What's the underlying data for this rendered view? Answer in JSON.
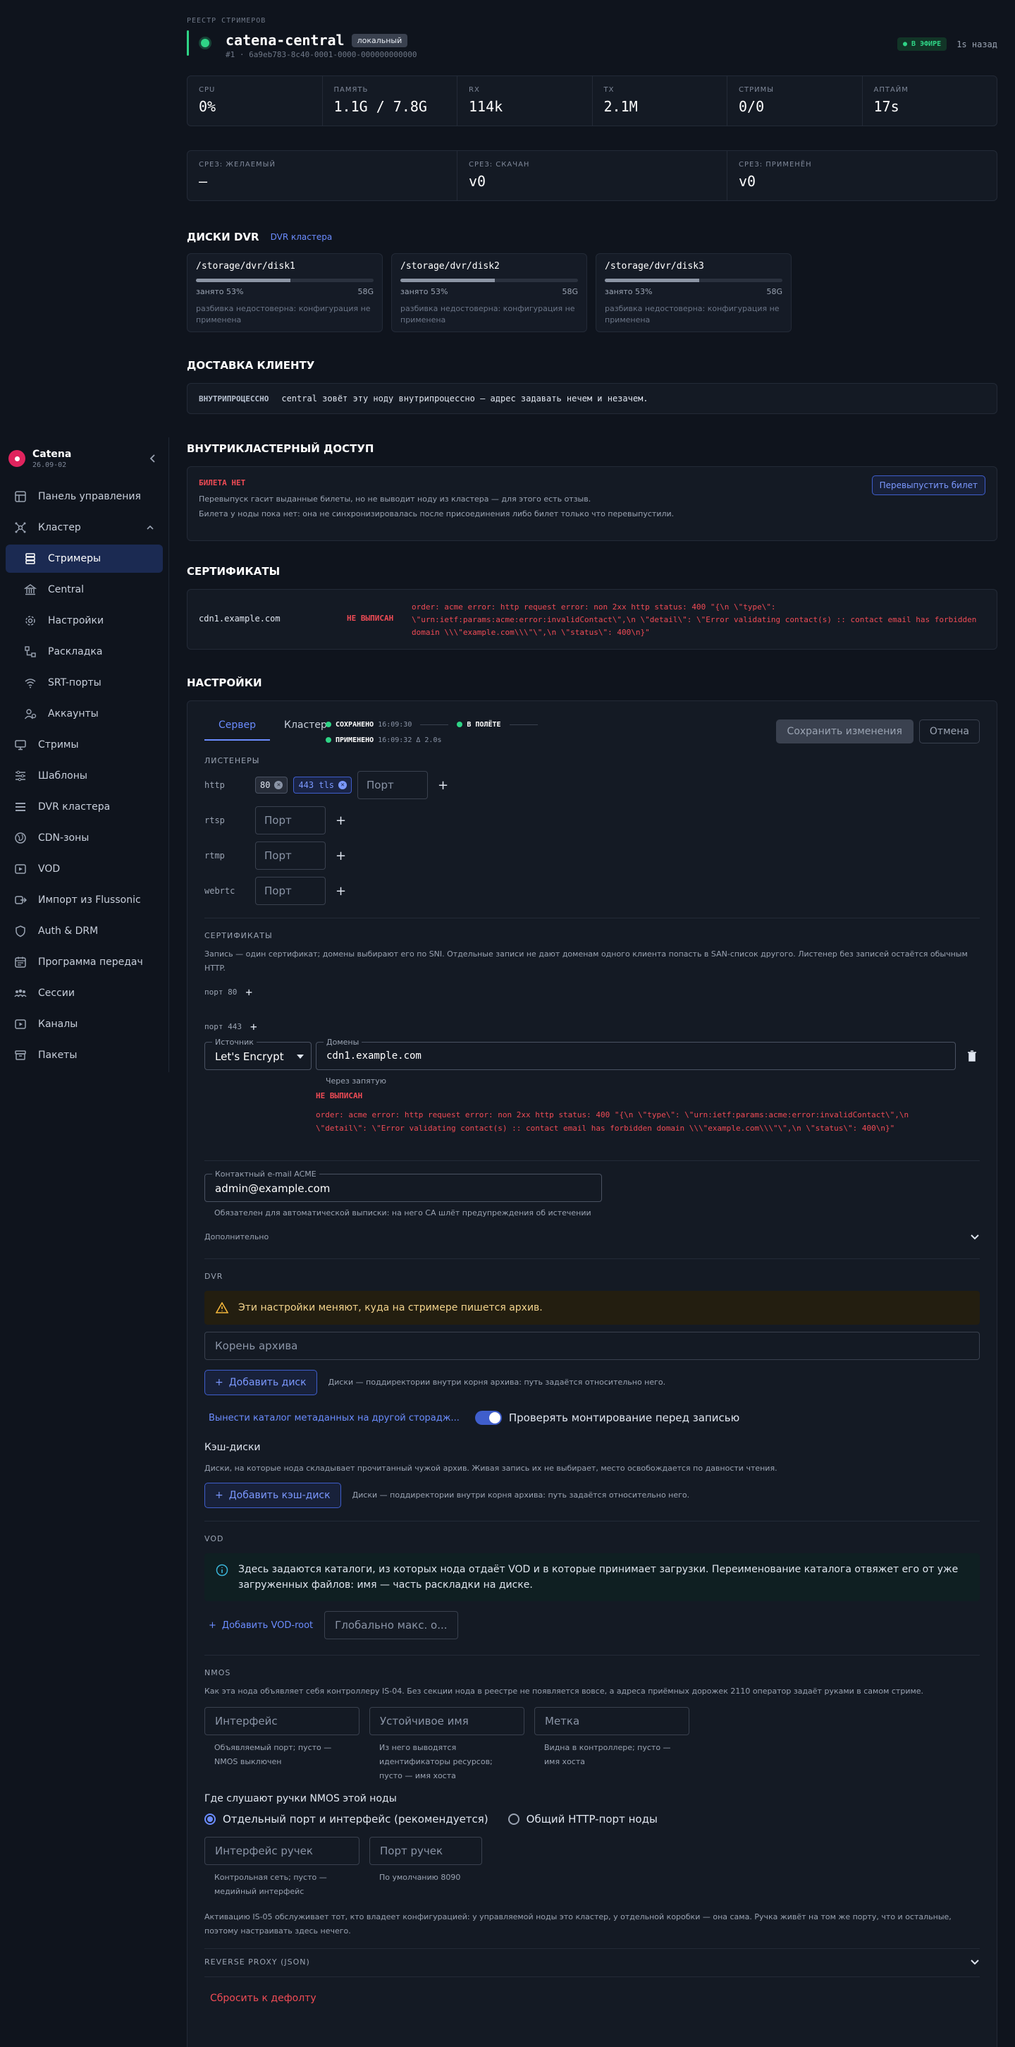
{
  "sidebar": {
    "brand": {
      "name": "Catena",
      "version": "26.09-02"
    },
    "items": [
      {
        "label": "Панель управления",
        "icon": "dashboard-icon"
      },
      {
        "label": "Кластер",
        "icon": "cluster-icon"
      },
      {
        "label": "Стримеры",
        "icon": "server-icon"
      },
      {
        "label": "Central",
        "icon": "bank-icon"
      },
      {
        "label": "Настройки",
        "icon": "gear-icon"
      },
      {
        "label": "Раскладка",
        "icon": "layout-icon"
      },
      {
        "label": "SRT-порты",
        "icon": "wifi-icon"
      },
      {
        "label": "Аккаунты",
        "icon": "users-icon"
      },
      {
        "label": "Стримы",
        "icon": "monitor-icon"
      },
      {
        "label": "Шаблоны",
        "icon": "sliders-icon"
      },
      {
        "label": "DVR кластера",
        "icon": "storage-icon"
      },
      {
        "label": "CDN-зоны",
        "icon": "globe-icon"
      },
      {
        "label": "VOD",
        "icon": "video-icon"
      },
      {
        "label": "Импорт из Flussonic",
        "icon": "import-icon"
      },
      {
        "label": "Auth & DRM",
        "icon": "shield-icon"
      },
      {
        "label": "Программа передач",
        "icon": "calendar-icon"
      },
      {
        "label": "Сессии",
        "icon": "sessions-icon"
      },
      {
        "label": "Каналы",
        "icon": "play-icon"
      },
      {
        "label": "Пакеты",
        "icon": "package-icon"
      }
    ]
  },
  "header": {
    "crumb": "РЕЕСТР СТРИМЕРОВ",
    "title": "catena-central",
    "badge": "локальный",
    "id": "#1 · 6a9eb783-8c40-0001-0000-000000000000",
    "status": "● В ЭФИРЕ",
    "ago": "1s назад"
  },
  "stats": [
    {
      "label": "CPU",
      "value": "0%"
    },
    {
      "label": "ПАМЯТЬ",
      "value": "1.1G / 7.8G"
    },
    {
      "label": "RX",
      "value": "114k"
    },
    {
      "label": "TX",
      "value": "2.1M"
    },
    {
      "label": "СТРИМЫ",
      "value": "0/0"
    },
    {
      "label": "АПТАЙМ",
      "value": "17s"
    }
  ],
  "slices": [
    {
      "label": "СРЕЗ: ЖЕЛАЕМЫЙ",
      "value": "—"
    },
    {
      "label": "СРЕЗ: СКАЧАН",
      "value": "v0"
    },
    {
      "label": "СРЕЗ: ПРИМЕНЁН",
      "value": "v0"
    }
  ],
  "dvr": {
    "title": "ДИСКИ DVR",
    "link": "DVR кластера",
    "disks": [
      {
        "path": "/storage/dvr/disk1",
        "used": "занято 53%",
        "size": "58G",
        "note": "разбивка недостоверна: конфигурация не применена",
        "fill": 0.53
      },
      {
        "path": "/storage/dvr/disk2",
        "used": "занято 53%",
        "size": "58G",
        "note": "разбивка недостоверна: конфигурация не применена",
        "fill": 0.53
      },
      {
        "path": "/storage/dvr/disk3",
        "used": "занято 53%",
        "size": "58G",
        "note": "разбивка недостоверна: конфигурация не применена",
        "fill": 0.53
      }
    ]
  },
  "delivery": {
    "title": "ДОСТАВКА КЛИЕНТУ",
    "tag": "ВНУТРИПРОЦЕССНО",
    "text": "central зовёт эту ноду внутрипроцессно — адрес задавать нечем и незачем."
  },
  "access": {
    "title": "ВНУТРИКЛАСТЕРНЫЙ ДОСТУП",
    "tag": "БИЛЕТА НЕТ",
    "button": "Перевыпустить билет",
    "line1": "Перевыпуск гасит выданные билеты, но не выводит ноду из кластера — для этого есть отзыв.",
    "line2": "Билета у ноды пока нет: она не синхронизировалась после присоединения либо билет только что перевыпустили."
  },
  "certs": {
    "title": "СЕРТИФИКАТЫ",
    "domain": "cdn1.example.com",
    "status": "НЕ ВЫПИСАН",
    "error": "order: acme error: http request error: non 2xx http status: 400 \"{\\n \\\"type\\\": \\\"urn:ietf:params:acme:error:invalidContact\\\",\\n \\\"detail\\\": \\\"Error validating contact(s) :: contact email has forbidden domain \\\\\\\"example.com\\\\\\\"\\\",\\n \\\"status\\\": 400\\n}\""
  },
  "settings": {
    "title": "НАСТРОЙКИ",
    "tabs": [
      "Сервер",
      "Кластер"
    ],
    "saved_label": "СОХРАНЕНО",
    "saved_time": "16:09:30",
    "inflight": "В ПОЛЁТЕ",
    "applied_label": "ПРИМЕНЕНО",
    "applied_time": "16:09:32 Δ 2.0s",
    "save_btn": "Сохранить изменения",
    "cancel_btn": "Отмена",
    "listeners_title": "ЛИСТЕНЕРЫ",
    "listeners": [
      {
        "proto": "http",
        "chips": [
          "80",
          "443 tls"
        ]
      },
      {
        "proto": "rtsp",
        "chips": []
      },
      {
        "proto": "rtmp",
        "chips": []
      },
      {
        "proto": "webrtc",
        "chips": []
      }
    ],
    "port_placeholder": "Порт",
    "certs_title": "СЕРТИФИКАТЫ",
    "certs_desc": "Запись — один сертификат; домены выбирают его по SNI. Отдельные записи не дают доменам одного клиента попасть в SAN-список другого. Листенер без записей остаётся обычным HTTP.",
    "port80": "порт 80",
    "port443": "порт 443",
    "source_label": "Источник",
    "source_value": "Let's Encrypt",
    "domains_label": "Домены",
    "domains_value": "cdn1.example.com",
    "domains_hint": "Через запятую",
    "cert_status": "НЕ ВЫПИСАН",
    "cert_error": "order: acme error: http request error: non 2xx http status: 400 \"{\\n \\\"type\\\": \\\"urn:ietf:params:acme:error:invalidContact\\\",\\n \\\"detail\\\": \\\"Error validating contact(s) :: contact email has forbidden domain \\\\\\\"example.com\\\\\\\"\\\",\\n \\\"status\\\": 400\\n}\"",
    "email_label": "Контактный e-mail ACME",
    "email_value": "admin@example.com",
    "email_hint": "Обязателен для автоматической выписки: на него CA шлёт предупреждения об истечении",
    "advanced": "Дополнительно",
    "dvr_title": "DVR",
    "dvr_warn": "Эти настройки меняют, куда на стримере пишется архив.",
    "archive_root_ph": "Корень архива",
    "add_disk": "Добавить диск",
    "disk_hint": "Диски — поддиректории внутри корня архива: путь задаётся относительно него.",
    "meta_link": "Вынести каталог метаданных на другой сторадж...",
    "check_mount": "Проверять монтирование перед записью",
    "cache_title": "Кэш-диски",
    "cache_desc": "Диски, на которые нода складывает прочитанный чужой архив. Живая запись их не выбирает, место освобождается по давности чтения.",
    "add_cache": "Добавить кэш-диск",
    "cache_hint": "Диски — поддиректории внутри корня архива: путь задаётся относительно него.",
    "vod_title": "VOD",
    "vod_info": "Здесь задаются каталоги, из которых нода отдаёт VOD и в которые принимает загрузки. Переименование каталога отвяжет его от уже загруженных файлов: имя — часть раскладки на диске.",
    "add_vod": "Добавить VOD-root",
    "vod_max_ph": "Глобально макс. о...",
    "nmos_title": "NMOS",
    "nmos_desc": "Как эта нода объявляет себя контроллеру IS-04. Без секции нода в реестре не появляется вовсе, а адреса приёмных дорожек 2110 оператор задаёт руками в самом стриме.",
    "nmos_iface_ph": "Интерфейс",
    "nmos_iface_hint": "Объявляемый порт; пусто — NMOS выключен",
    "nmos_name_ph": "Устойчивое имя",
    "nmos_name_hint": "Из него выводятся идентификаторы ресурсов; пусто — имя хоста",
    "nmos_label_ph": "Метка",
    "nmos_label_hint": "Видна в контроллере; пусто — имя хоста",
    "handles_title": "Где слушают ручки NMOS этой ноды",
    "radio1": "Отдельный порт и интерфейс (рекомендуется)",
    "radio2": "Общий HTTP-порт ноды",
    "handle_iface_ph": "Интерфейс ручек",
    "handle_iface_hint": "Контрольная сеть; пусто — медийный интерфейс",
    "handle_port_ph": "Порт ручек",
    "handle_port_hint": "По умолчанию 8090",
    "is05": "Активацию IS-05 обслуживает тот, кто владеет конфигурацией: у управляемой ноды это кластер, у отдельной коробки — она сама. Ручка живёт на том же порту, что и остальные, поэтому настраивать здесь нечего.",
    "reverse_proxy": "REVERSE PROXY (JSON)",
    "reset": "Сбросить к дефолту"
  }
}
